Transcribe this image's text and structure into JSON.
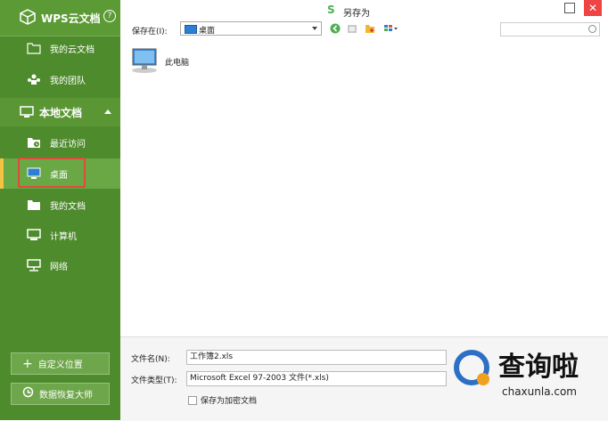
{
  "sidebar": {
    "brand": "WPS云文档",
    "help": "?",
    "cloud_items": [
      "我的云文档",
      "我的团队"
    ],
    "section": "本地文档",
    "local_items": [
      "最近访问",
      "桌面",
      "我的文档",
      "计算机",
      "网络"
    ],
    "buttons": [
      "自定义位置",
      "数据恢复大师"
    ]
  },
  "titlebar": {
    "logo": "S",
    "title": "另存为",
    "close": "✕"
  },
  "toolbar": {
    "save_in_label": "保存在(I):",
    "location": "桌面"
  },
  "files": [
    {
      "name": "此电脑"
    }
  ],
  "bottom": {
    "filename_label": "文件名(N):",
    "filename_value": "工作簿2.xls",
    "filetype_label": "文件类型(T):",
    "filetype_value": "Microsoft Excel 97-2003 文件(*.xls)",
    "encrypt_label": "保存为加密文档"
  },
  "watermark": {
    "big": "查询啦",
    "small": "chaxunla.com"
  }
}
